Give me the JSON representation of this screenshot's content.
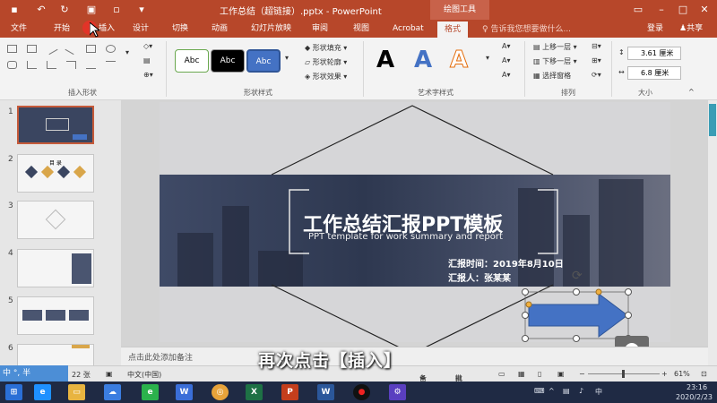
{
  "titlebar": {
    "doc_title": "工作总结（超链接）.pptx - PowerPoint",
    "tool_title": "绘图工具",
    "window_buttons": [
      "restore-icon",
      "minimize-icon",
      "maximize-icon",
      "close-icon"
    ]
  },
  "tabs": [
    "文件",
    "开始",
    "插入",
    "设计",
    "切换",
    "动画",
    "幻灯片放映",
    "审阅",
    "视图",
    "Acrobat",
    "格式"
  ],
  "active_tab": "格式",
  "tell_me": "告诉我您想要做什么...",
  "account": {
    "login": "登录",
    "share": "共享"
  },
  "ribbon": {
    "groups": {
      "insert_shapes": "插入形状",
      "shape_styles": "形状样式",
      "wordart_styles": "艺术字样式",
      "arrange": "排列",
      "size": "大小"
    },
    "style_samples": [
      "Abc",
      "Abc",
      "Abc"
    ],
    "fill": "形状填充",
    "outline": "形状轮廓",
    "effects": "形状效果",
    "wordart_sample": "A",
    "bring_forward": "上移一层",
    "send_backward": "下移一层",
    "selection_pane": "选择窗格",
    "height": "3.61 厘米",
    "width": "6.8 厘米"
  },
  "slides": [
    "1",
    "2",
    "3",
    "4",
    "5",
    "6"
  ],
  "slide_2_title": "目 录",
  "slide": {
    "title": "工作总结汇报PPT模板",
    "subtitle": "PPT template for work summary and report",
    "report_time": "汇报时间：2019年8月10日",
    "reporter": "汇报人：张某某"
  },
  "notes_placeholder": "点击此处添加备注",
  "status": {
    "slide_info": "22 张",
    "language": "中文(中国)",
    "notes": "备注",
    "comments": "批注",
    "zoom": "61%"
  },
  "ime": "中 °, 半 ",
  "caption": "再次点击【插入】",
  "taskbar": {
    "time": "23:16",
    "date": "2020/2/23"
  },
  "colors": {
    "accent": "#b7472a",
    "arrow": "#4472c4",
    "banner": "#3b4560"
  }
}
